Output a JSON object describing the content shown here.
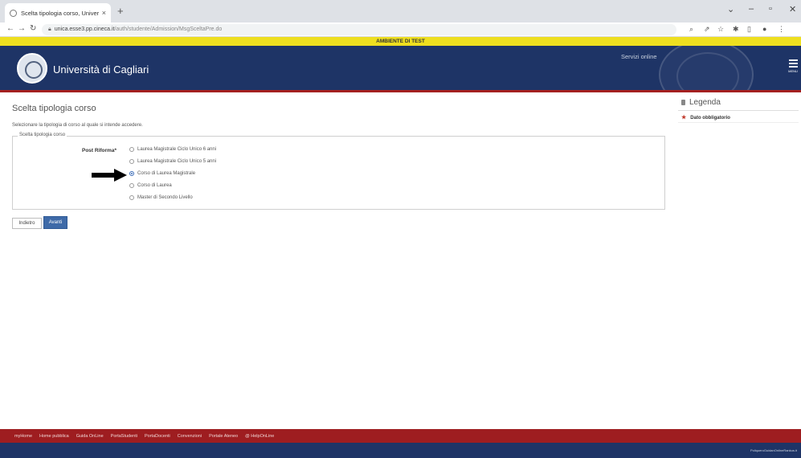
{
  "browser": {
    "tab_title": "Scelta tipologia corso, Università",
    "tab_close": "×",
    "new_tab": "+",
    "url_host": "unica.esse3.pp.cineca.it",
    "url_path": "/auth/studente/Admission/MsgSceltaPre.do"
  },
  "banner": {
    "text": "AMBIENTE DI TEST"
  },
  "header": {
    "university_name": "Università di Cagliari",
    "servizi_online": "Servizi online",
    "menu_label": "MENU"
  },
  "main": {
    "title": "Scelta tipologia corso",
    "intro": "Selezionare la tipologia di corso al quale si intende accedere.",
    "fieldset_legend": "Scelta tipologia corso",
    "field_label": "Post Riforma*",
    "options": [
      {
        "label": "Laurea Magistrale Ciclo Unico 6 anni",
        "checked": false
      },
      {
        "label": "Laurea Magistrale Ciclo Unico 5 anni",
        "checked": false
      },
      {
        "label": "Corso di Laurea Magistrale",
        "checked": true
      },
      {
        "label": "Corso di Laurea",
        "checked": false
      },
      {
        "label": "Master di Secondo Livello",
        "checked": false
      }
    ],
    "back_button": "Indietro",
    "next_button": "Avanti"
  },
  "sidebar": {
    "title": "Legenda",
    "item_label": "Dato obbligatorio"
  },
  "footer": {
    "links": [
      "myHome",
      "Home pubblica",
      "Guida OnLine",
      "PortaStudenti",
      "PortaDocenti",
      "Convenzioni",
      "Portale Ateneo",
      "@ HelpOnLine"
    ],
    "right_text": "PoliqueroGuidanOnlineRankus.it"
  },
  "colors": {
    "header_bg": "#1e3466",
    "header_border": "#a42020",
    "test_banner": "#eedf1f",
    "footer_red": "#9e1d20",
    "primary_button": "#3e6aa8",
    "required_star": "#c0392b"
  }
}
